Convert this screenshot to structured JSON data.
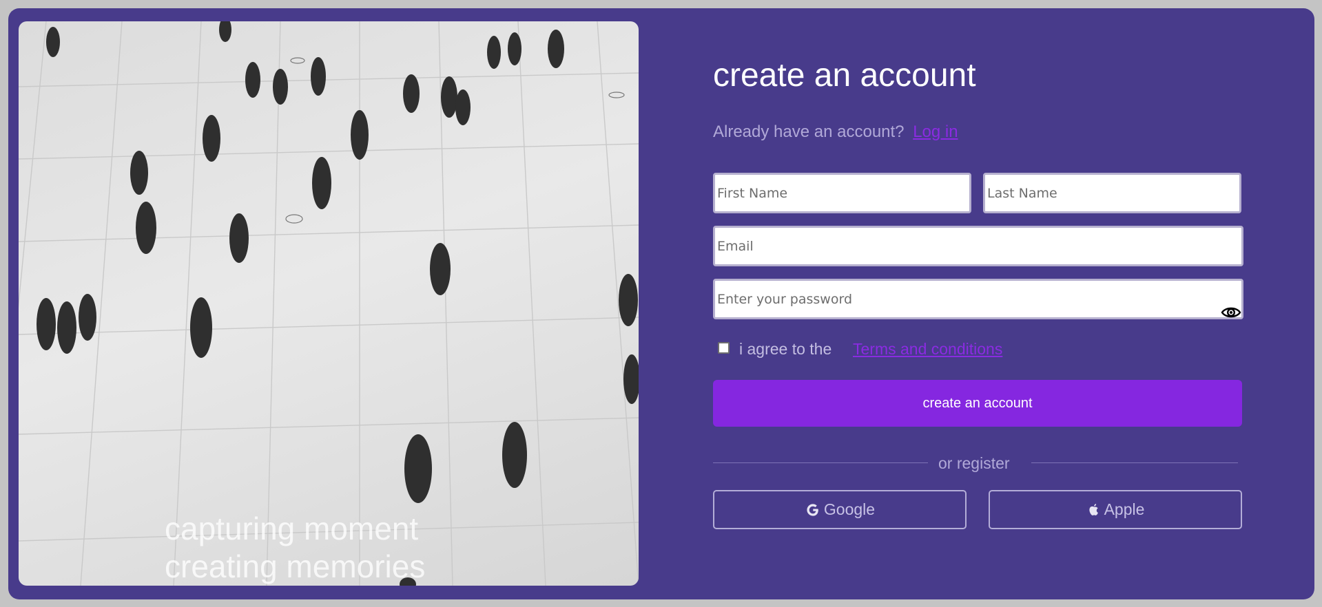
{
  "hero": {
    "caption_line1": "capturing moment",
    "caption_line2": "creating memories"
  },
  "form": {
    "title": "create an account",
    "login_prompt": "Already have an account?",
    "login_link": "Log in",
    "first_name_placeholder": "First Name",
    "last_name_placeholder": "Last Name",
    "email_placeholder": "Email",
    "password_placeholder": "Enter your password",
    "agree_text": "i agree to the",
    "terms_link": "Terms and conditions",
    "submit_label": "create an account",
    "divider_text": "or register",
    "google_label": "Google",
    "apple_label": "Apple",
    "password_toggle_icon": "eye-icon",
    "google_icon": "google-icon",
    "apple_icon": "apple-icon"
  },
  "colors": {
    "page_background": "#c4c4c4",
    "card_background": "#483b8b",
    "accent": "#8527e0",
    "link": "#8b2be2"
  }
}
